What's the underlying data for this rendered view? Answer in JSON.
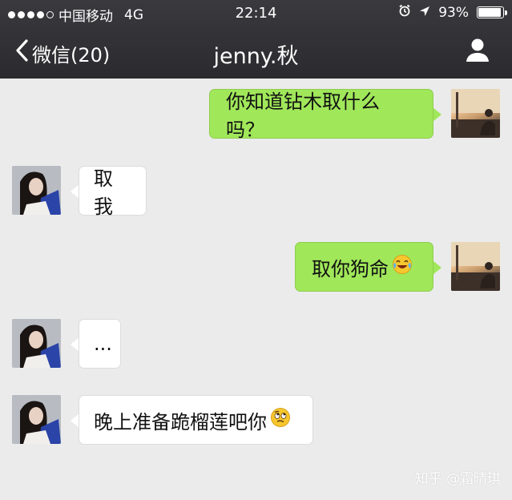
{
  "status_bar": {
    "carrier": "中国移动",
    "network": "4G",
    "time": "22:14",
    "battery": "93%",
    "battery_level": 0.93
  },
  "nav": {
    "back_label": "微信(20)",
    "title": "jenny.秋"
  },
  "messages": [
    {
      "side": "out",
      "text": "你知道钻木取什么吗？"
    },
    {
      "side": "in",
      "text": "取我"
    },
    {
      "side": "out",
      "text": "取你狗命",
      "emoji": "tears-of-joy-emoji"
    },
    {
      "side": "in",
      "text": "..."
    },
    {
      "side": "in",
      "text": "晚上准备跪榴莲吧你",
      "emoji": "rolling-eyes-emoji"
    }
  ],
  "watermark": "知乎 @霜晴琪",
  "colors": {
    "outgoing_bubble": "#a0e75a",
    "incoming_bubble": "#ffffff",
    "chat_background": "#ebebeb",
    "nav_background": "#2f2f33"
  }
}
